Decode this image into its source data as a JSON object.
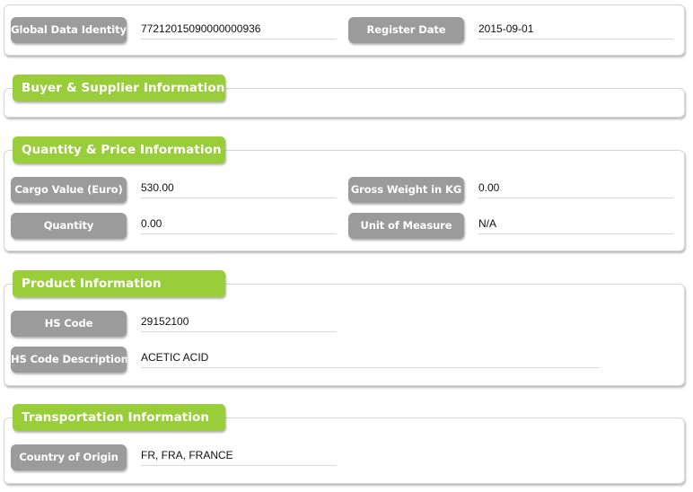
{
  "identity": {
    "global_data_identity_label": "Global Data Identity",
    "global_data_identity_value": "77212015090000000936",
    "register_date_label": "Register Date",
    "register_date_value": "2015-09-01"
  },
  "buyer_supplier": {
    "title": "Buyer & Supplier Information"
  },
  "quantity_price": {
    "title": "Quantity & Price Information",
    "cargo_value_label": "Cargo Value (Euro)",
    "cargo_value_value": "530.00",
    "gross_weight_label": "Gross Weight in KG",
    "gross_weight_value": "0.00",
    "quantity_label": "Quantity",
    "quantity_value": "0.00",
    "unit_label": "Unit of Measure",
    "unit_value": "N/A"
  },
  "product": {
    "title": "Product Information",
    "hs_code_label": "HS Code",
    "hs_code_value": "29152100",
    "hs_desc_label": "HS Code Description",
    "hs_desc_value": "ACETIC ACID"
  },
  "transportation": {
    "title": "Transportation Information",
    "country_label": "Country of Origin",
    "country_value": "FR, FRA, FRANCE"
  }
}
